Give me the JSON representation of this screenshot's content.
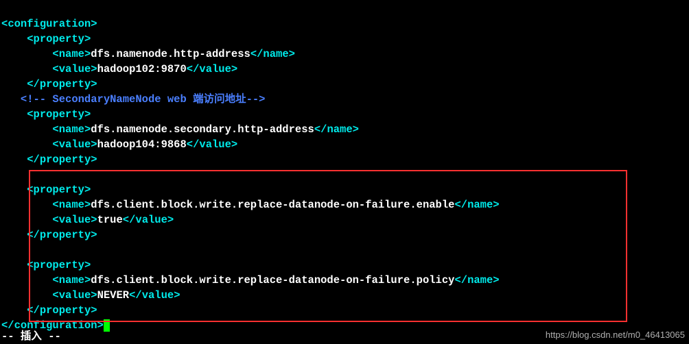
{
  "tags": {
    "configuration_open": "configuration",
    "configuration_close": "configuration",
    "property_open": "property",
    "property_close": "property",
    "name_open": "name",
    "name_close": "name",
    "value_open": "value",
    "value_close": "value"
  },
  "block1": {
    "name": "dfs.namenode.http-address",
    "value": "hadoop102:9870"
  },
  "comment": {
    "prefix": "<!-- ",
    "text": "SecondaryNameNode web ",
    "cjk": "端访问地址",
    "suffix": "-->"
  },
  "block2": {
    "name": "dfs.namenode.secondary.http-address",
    "value": "hadoop104:9868"
  },
  "block3": {
    "name": "dfs.client.block.write.replace-datanode-on-failure.enable",
    "value": "true"
  },
  "block4": {
    "name": "dfs.client.block.write.replace-datanode-on-failure.policy",
    "value": "NEVER"
  },
  "status": "-- 插入 --",
  "watermark": "https://blog.csdn.net/m0_46413065"
}
